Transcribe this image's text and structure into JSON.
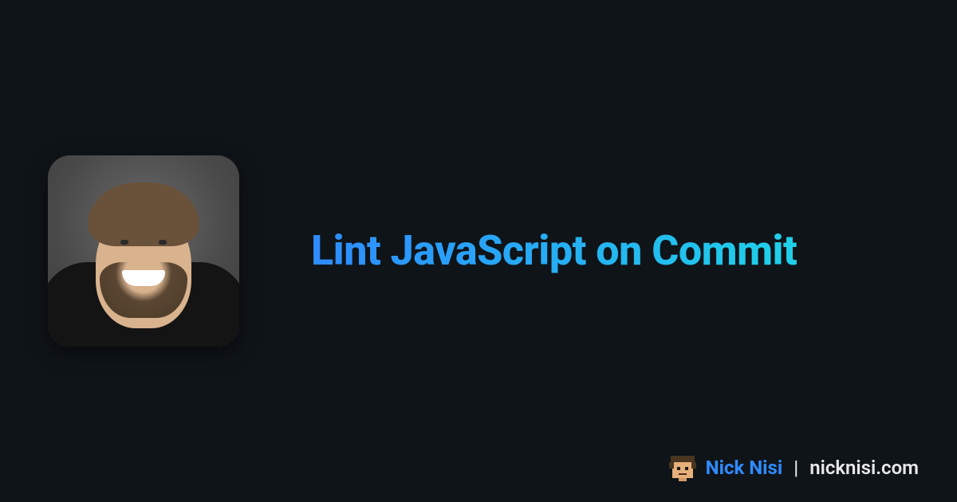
{
  "title": "Lint JavaScript on Commit",
  "author": {
    "name": "Nick Nisi",
    "site": "nicknisi.com",
    "separator": "|"
  },
  "colors": {
    "background": "#0f1419",
    "gradient_start": "#2e8bff",
    "gradient_end": "#1fd1e8",
    "text_light": "#e8e8e8"
  },
  "icons": {
    "avatar_pixel": "pixel-face-icon",
    "avatar_photo": "author-headshot"
  }
}
